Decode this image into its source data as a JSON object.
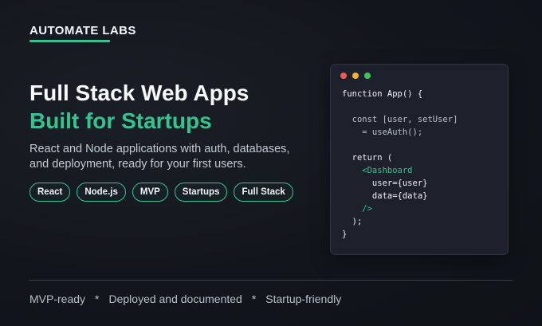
{
  "brand": {
    "name": "AUTOMATE LABS",
    "accent_color": "#34c48e"
  },
  "hero": {
    "title": "Full Stack Web Apps",
    "subtitle": "Built for Startups",
    "description_line1": "React and Node applications with auth, databases,",
    "description_line2": "and deployment, ready for your first users."
  },
  "tags": [
    "React",
    "Node.js",
    "MVP",
    "Startups",
    "Full Stack"
  ],
  "code_window": {
    "lines": [
      "function App() {",
      "",
      "  const [user, setUser]",
      "    = useAuth();",
      "",
      "  return (",
      "    <Dashboard",
      "      user={user}",
      "      data={data}",
      "    />",
      "  );",
      "}"
    ],
    "window_controls": [
      "close",
      "minimize",
      "maximize"
    ]
  },
  "footer": {
    "items": [
      "MVP-ready",
      "Deployed and documented",
      "Startup-friendly"
    ],
    "separator": "*"
  }
}
